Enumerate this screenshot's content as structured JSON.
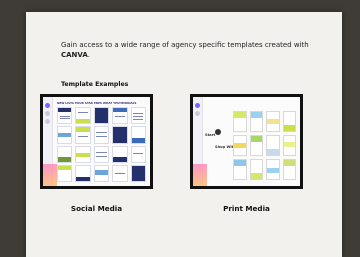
{
  "intro": {
    "text_before": "Gain access to a wide range of agency specific templates created with ",
    "brand": "CANVA",
    "text_after": "."
  },
  "section_title": "Template Examples",
  "templates": [
    {
      "caption": "Social Media",
      "preview_title": "NEW LISTA POUR STAR PRES WHAT TESTIMONIALS"
    },
    {
      "caption": "Print Media",
      "preview_word_1": "Start",
      "preview_word_2": "Shop With"
    }
  ],
  "colors": {
    "card_bg": "#f3f1ed",
    "page_bg": "#3f3b36",
    "accent_pink": "#ff7ab6",
    "accent_orange": "#ffb35c",
    "accent_green": "#c9df4e",
    "accent_navy": "#23306b"
  }
}
